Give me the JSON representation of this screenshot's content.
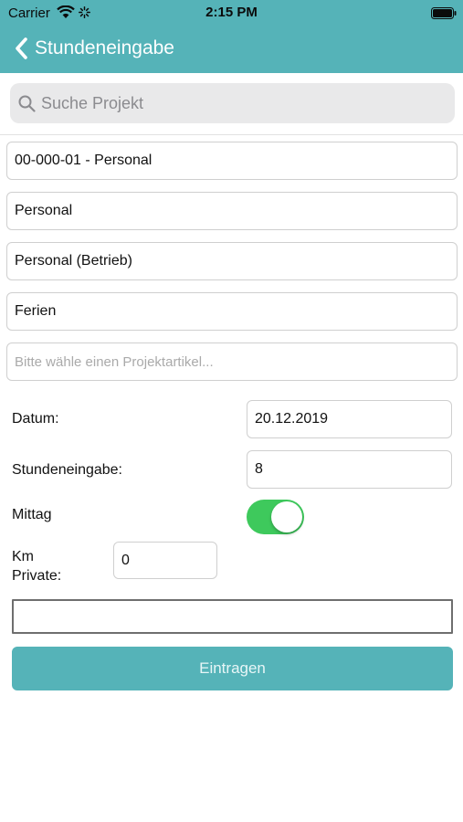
{
  "status_bar": {
    "carrier": "Carrier",
    "time": "2:15 PM"
  },
  "nav": {
    "title": "Stundeneingabe",
    "back_icon": "chevron-left-icon"
  },
  "search": {
    "placeholder": "Suche Projekt",
    "value": ""
  },
  "fields": {
    "project": "00-000-01 - Personal",
    "category": "Personal",
    "subcategory": "Personal (Betrieb)",
    "activity": "Ferien",
    "article_placeholder": "Bitte wähle einen Projektartikel..."
  },
  "form": {
    "date_label": "Datum:",
    "date_value": "20.12.2019",
    "hours_label": "Stundeneingabe:",
    "hours_value": "8",
    "lunch_label": "Mittag",
    "lunch_on": true,
    "km_label_line1": "Km",
    "km_label_line2": "Private:",
    "km_value": "0",
    "note_value": ""
  },
  "submit_label": "Eintragen",
  "colors": {
    "accent": "#55b3b8",
    "toggle_on": "#3ec95c"
  }
}
